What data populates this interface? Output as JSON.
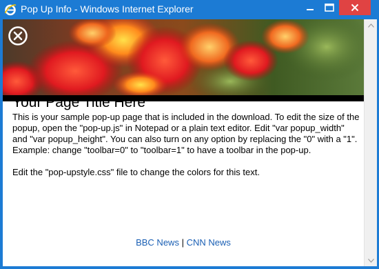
{
  "window": {
    "title": "Pop Up Info - Windows Internet Explorer",
    "controls": {
      "minimize_icon": "minimize-icon",
      "maximize_icon": "maximize-icon",
      "close_icon": "close-icon"
    },
    "colors": {
      "frame": "#1c7bd4",
      "close_button": "#e04343"
    }
  },
  "page": {
    "close_icon": "close-circle-icon",
    "title": "Your Page Title Here",
    "paragraph1": "This is your sample pop-up page that is included in the download. To edit the size of the popup, open the \"pop-up.js\" in Notepad or a plain text editor. Edit \"var popup_width\" and \"var popup_height\". You can also turn on any option by replacing the \"0\" with a \"1\". Example: change \"toolbar=0\" to \"toolbar=1\" to have a toolbar in the pop-up.",
    "paragraph2": "Edit the \"pop-upstyle.css\" file to change the colors for this text.",
    "links": [
      {
        "label": "BBC News"
      },
      {
        "label": "CNN News"
      }
    ],
    "link_separator": "|",
    "link_color": "#1a5fb4"
  }
}
